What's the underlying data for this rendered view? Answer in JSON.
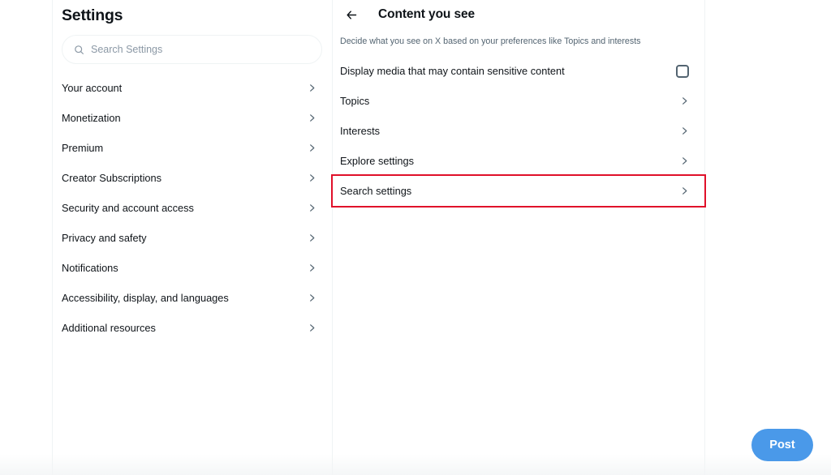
{
  "sidebar": {
    "title": "Settings",
    "search": {
      "placeholder": "Search Settings",
      "value": "",
      "icon": "search-icon"
    },
    "items": [
      {
        "label": "Your account",
        "chevron": "chevron-right-icon"
      },
      {
        "label": "Monetization",
        "chevron": "chevron-right-icon"
      },
      {
        "label": "Premium",
        "chevron": "chevron-right-icon"
      },
      {
        "label": "Creator Subscriptions",
        "chevron": "chevron-right-icon"
      },
      {
        "label": "Security and account access",
        "chevron": "chevron-right-icon"
      },
      {
        "label": "Privacy and safety",
        "chevron": "chevron-right-icon"
      },
      {
        "label": "Notifications",
        "chevron": "chevron-right-icon"
      },
      {
        "label": "Accessibility, display, and languages",
        "chevron": "chevron-right-icon"
      },
      {
        "label": "Additional resources",
        "chevron": "chevron-right-icon"
      }
    ]
  },
  "content": {
    "back_icon": "arrow-left-icon",
    "title": "Content you see",
    "subtitle": "Decide what you see on X based on your preferences like Topics and interests",
    "rows": [
      {
        "label": "Display media that may contain sensitive content",
        "control": "checkbox",
        "checked": false,
        "highlighted": false
      },
      {
        "label": "Topics",
        "control": "chevron-right-icon",
        "highlighted": false
      },
      {
        "label": "Interests",
        "control": "chevron-right-icon",
        "highlighted": false
      },
      {
        "label": "Explore settings",
        "control": "chevron-right-icon",
        "highlighted": false
      },
      {
        "label": "Search settings",
        "control": "chevron-right-icon",
        "highlighted": true
      }
    ]
  },
  "compose": {
    "post_label": "Post"
  },
  "colors": {
    "accent": "#4a99e9",
    "text_primary": "#0f1419",
    "text_secondary": "#536471",
    "border": "#eff3f4",
    "highlight": "#e0102a"
  }
}
